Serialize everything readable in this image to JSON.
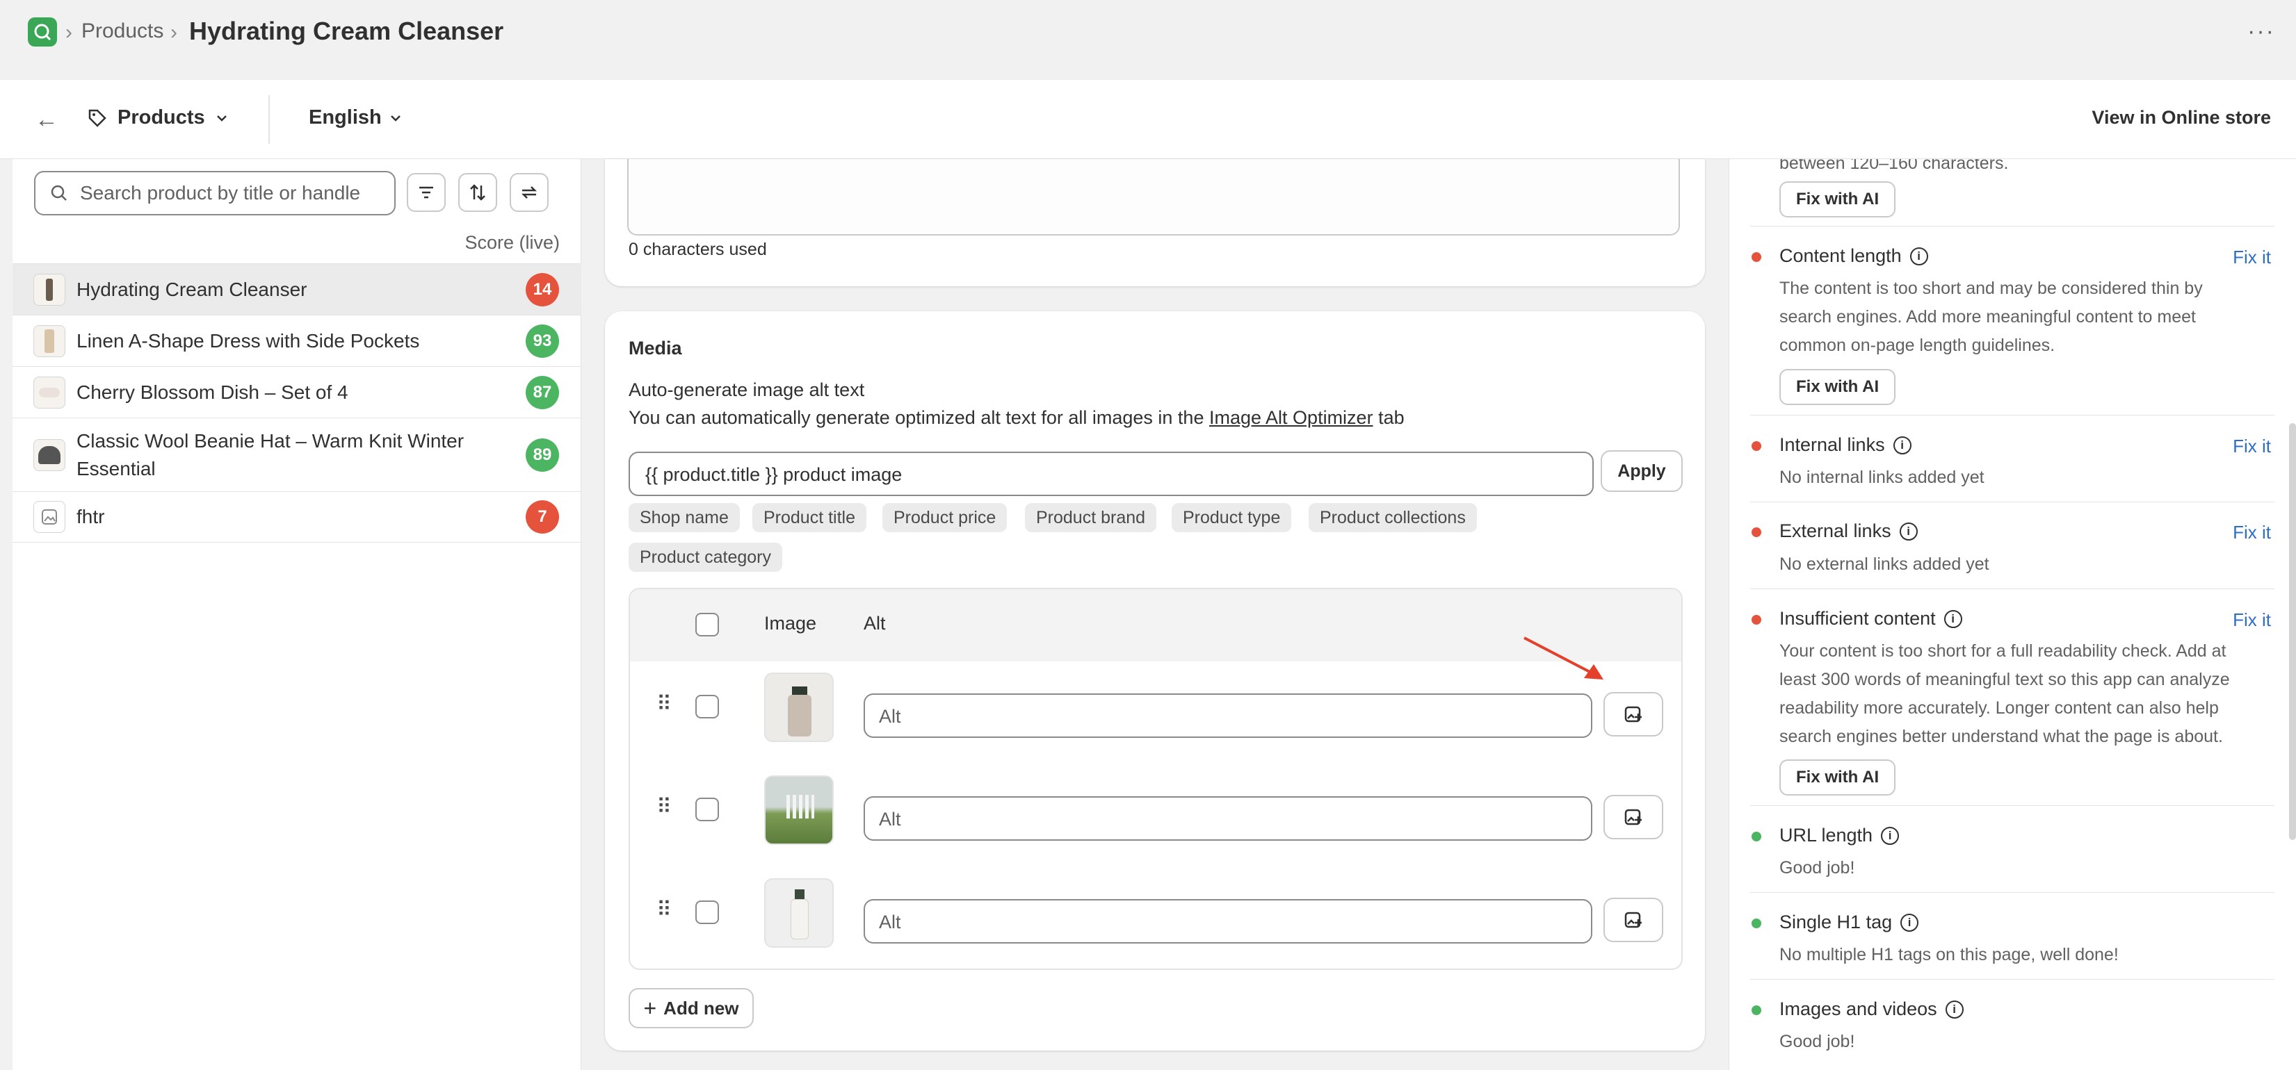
{
  "breadcrumb": {
    "parent": "Products",
    "title": "Hydrating Cream Cleanser"
  },
  "nav": {
    "resource": "Products",
    "language": "English",
    "view_store": "View in Online store"
  },
  "sidebar": {
    "search_placeholder": "Search product by title or handle",
    "score_header": "Score (live)",
    "products": [
      {
        "name": "Hydrating Cream Cleanser",
        "score": "14",
        "status": "red"
      },
      {
        "name": "Linen A-Shape Dress with Side Pockets",
        "score": "93",
        "status": "green"
      },
      {
        "name": "Cherry Blossom Dish – Set of 4",
        "score": "87",
        "status": "green"
      },
      {
        "name": "Classic Wool Beanie Hat – Warm Knit Winter Essential",
        "score": "89",
        "status": "green"
      },
      {
        "name": "fhtr",
        "score": "7",
        "status": "red"
      }
    ]
  },
  "description": {
    "chars_used": "0 characters used"
  },
  "media": {
    "title": "Media",
    "autogen_title": "Auto-generate image alt text",
    "autogen_desc_before": "You can automatically generate optimized alt text for all images in the",
    "autogen_link": "Image Alt Optimizer",
    "autogen_desc_after": "tab",
    "template_value": "{{ product.title }} product image",
    "apply_label": "Apply",
    "chips": [
      "Shop name",
      "Product title",
      "Product price",
      "Product brand",
      "Product type",
      "Product collections",
      "Product category"
    ],
    "col_image": "Image",
    "col_alt": "Alt",
    "alt_placeholder": "Alt",
    "add_new_label": "Add new"
  },
  "checks": {
    "top_desc": "between 120–160 characters.",
    "fix_ai_label": "Fix with AI",
    "fix_it_label": "Fix it",
    "content_length": {
      "title": "Content length",
      "desc": "The content is too short and may be considered thin by search engines. Add more meaningful content to meet common on-page length guidelines."
    },
    "internal_links": {
      "title": "Internal links",
      "desc": "No internal links added yet"
    },
    "external_links": {
      "title": "External links",
      "desc": "No external links added yet"
    },
    "insufficient_content": {
      "title": "Insufficient content",
      "desc": "Your content is too short for a full readability check. Add at least 300 words of meaningful text so this app can analyze readability more accurately. Longer content can also help search engines better understand what the page is about."
    },
    "url_length": {
      "title": "URL length",
      "desc": "Good job!"
    },
    "single_h1": {
      "title": "Single H1 tag",
      "desc": "No multiple H1 tags on this page, well done!"
    },
    "images_videos": {
      "title": "Images and videos",
      "desc": "Good job!"
    }
  },
  "colors": {
    "red": "#e5533d",
    "green": "#4cb562",
    "link": "#2c6ecb",
    "arrow": "#e5402a"
  }
}
